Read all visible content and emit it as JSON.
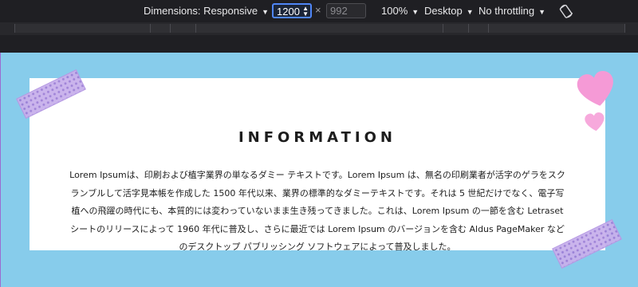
{
  "toolbar": {
    "dimensions_label": "Dimensions: Responsive",
    "width_value": "1200",
    "height_placeholder": "992",
    "times_symbol": "×",
    "zoom": "100%",
    "device_type": "Desktop",
    "throttling": "No throttling",
    "caret": "▼"
  },
  "page": {
    "title": "INFORMATION",
    "body": "Lorem Ipsumは、印刷および植字業界の単なるダミー テキストです。Lorem Ipsum は、無名の印刷業者が活字のゲラをスクランブルして活字見本帳を作成した 1500 年代以来、業界の標準的なダミーテキストです。それは 5 世紀だけでなく、電子写植への飛躍の時代にも、本質的には変わっていないまま生き残ってきました。これは、Lorem Ipsum の一節を含む Letraset シートのリリースによって 1960 年代に普及し、さらに最近では Lorem Ipsum のバージョンを含む Aldus PageMaker などのデスクトップ パブリッシング ソフトウェアによって普及しました。"
  },
  "colors": {
    "viewport_bg": "#87cceb",
    "card_bg": "#ffffff",
    "tape": "#c8b0ec",
    "heart": "#f59ad6",
    "accent_focus": "#4f86f7"
  },
  "icons": [
    "rotate-icon",
    "heart-icon",
    "tape-decoration"
  ]
}
